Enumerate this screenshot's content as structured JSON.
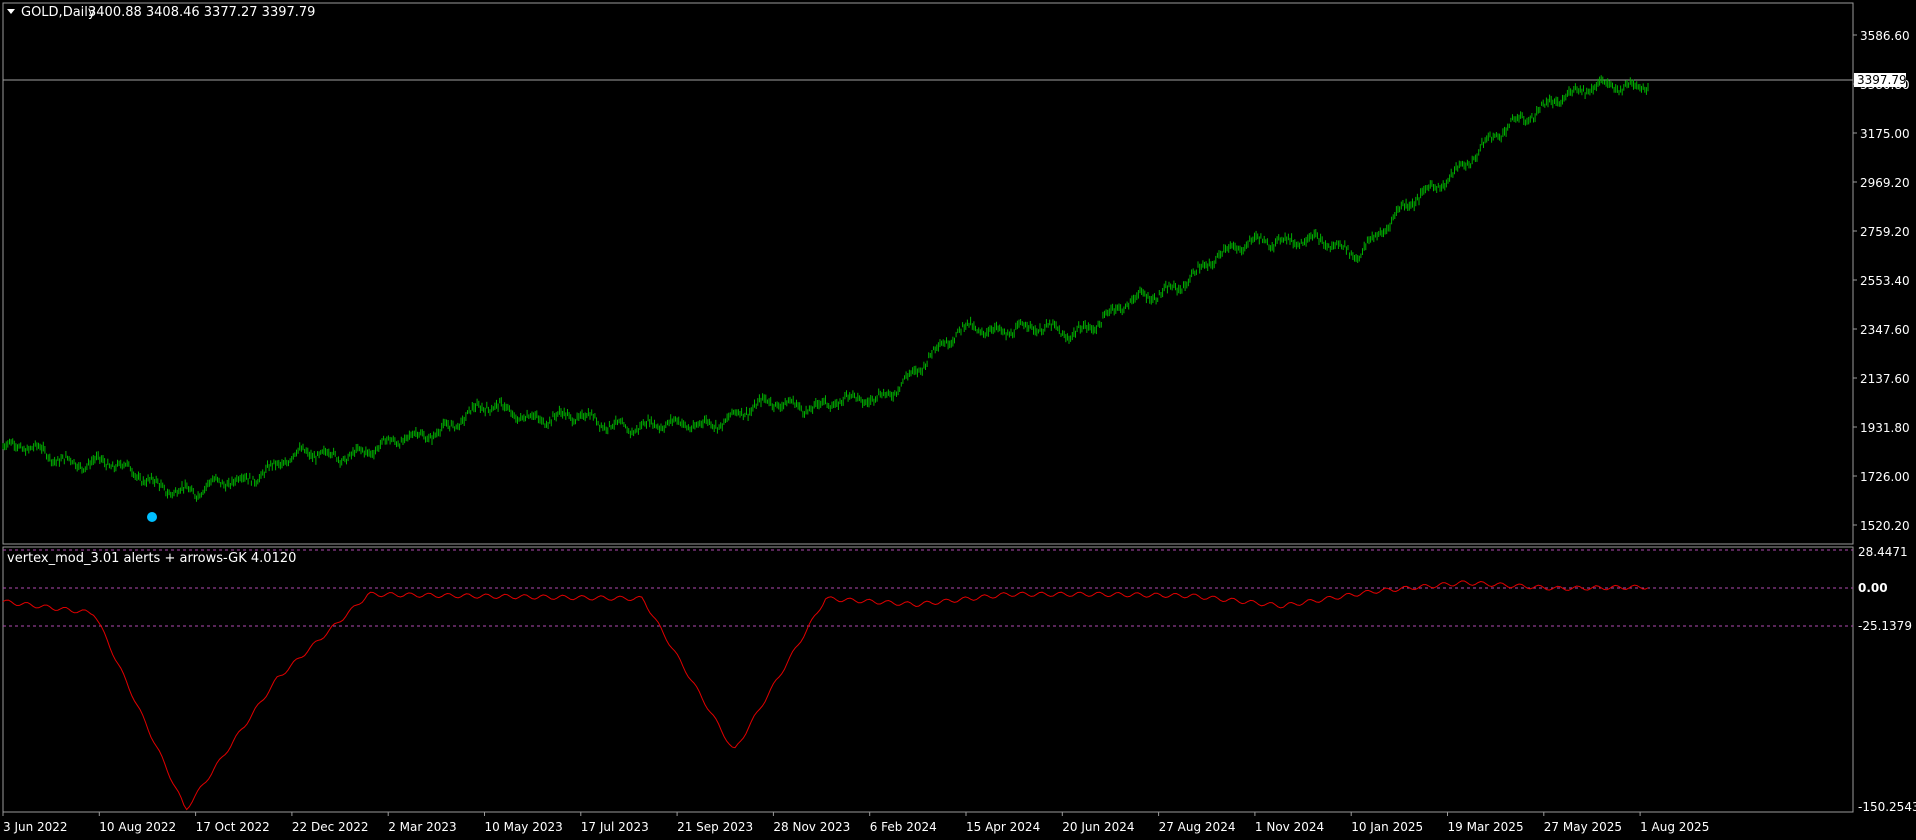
{
  "header": {
    "symbol": "GOLD,Daily",
    "ohlc": "3400.88 3408.46 3377.27 3397.79",
    "dropdown_icon": "triangle-down-icon"
  },
  "indicator": {
    "name": "vertex_mod_3.01 alerts + arrows-GK 4.0120",
    "levels": [
      "25.1379",
      "0.00",
      "-25.1379",
      "-150.2543"
    ],
    "top_label": "28.4471"
  },
  "price_axis": {
    "ticks": [
      "3586.60",
      "3380.80",
      "3175.00",
      "2969.20",
      "2759.20",
      "2553.40",
      "2347.60",
      "2137.60",
      "1931.80",
      "1726.00",
      "1520.20"
    ],
    "current_price": "3397.79"
  },
  "time_axis": {
    "ticks": [
      "3 Jun 2022",
      "10 Aug 2022",
      "17 Oct 2022",
      "22 Dec 2022",
      "2 Mar 2023",
      "10 May 2023",
      "17 Jul 2023",
      "21 Sep 2023",
      "28 Nov 2023",
      "6 Feb 2024",
      "15 Apr 2024",
      "20 Jun 2024",
      "27 Aug 2024",
      "1 Nov 2024",
      "10 Jan 2025",
      "19 Mar 2025",
      "27 May 2025",
      "1 Aug 2025"
    ]
  },
  "colors": {
    "background": "#000000",
    "price_bars": "#00b000",
    "indicator_line": "#e00000",
    "level_lines": "#b04ab0",
    "signal_dot": "#00bfff",
    "price_line": "#a0a0a0"
  },
  "chart_data": [
    {
      "type": "line",
      "name_label": "GOLD,Daily",
      "x": [
        "3 Jun 2022",
        "10 Aug 2022",
        "17 Oct 2022",
        "22 Dec 2022",
        "2 Mar 2023",
        "10 May 2023",
        "17 Jul 2023",
        "21 Sep 2023",
        "28 Nov 2023",
        "6 Feb 2024",
        "15 Apr 2024",
        "20 Jun 2024",
        "27 Aug 2024",
        "1 Nov 2024",
        "10 Jan 2025",
        "19 Mar 2025",
        "27 May 2025",
        "1 Aug 2025"
      ],
      "values": [
        1850,
        1780,
        1650,
        1800,
        1850,
        2010,
        1960,
        1930,
        2030,
        2040,
        2360,
        2330,
        2510,
        2740,
        2680,
        3020,
        3320,
        3398
      ],
      "ylim": [
        1520.2,
        3586.6
      ],
      "signal_points": [
        {
          "x": "10 Aug 2022",
          "y": 1610
        }
      ]
    },
    {
      "type": "line",
      "name_label": "vertex_mod_3.01 alerts + arrows-GK 4.0120",
      "x": [
        "3 Jun 2022",
        "10 Aug 2022",
        "1 Sep 2022",
        "17 Oct 2022",
        "22 Dec 2022",
        "2 Mar 2023",
        "10 May 2023",
        "17 Jul 2023",
        "21 Sep 2023",
        "28 Nov 2023",
        "6 Feb 2024",
        "15 Apr 2024",
        "20 Jun 2024",
        "27 Aug 2024",
        "1 Nov 2024",
        "10 Jan 2025",
        "19 Mar 2025",
        "27 May 2025",
        "1 Aug 2025"
      ],
      "values": [
        -7,
        -15,
        -150,
        -60,
        -2,
        -3,
        -4,
        -5,
        -110,
        -5,
        -9,
        -2,
        -2,
        -3,
        -10,
        0,
        6,
        2,
        3
      ],
      "levels": [
        25.1379,
        0,
        -25.1379
      ],
      "ylim": [
        -150.2543,
        28.4471
      ]
    }
  ]
}
